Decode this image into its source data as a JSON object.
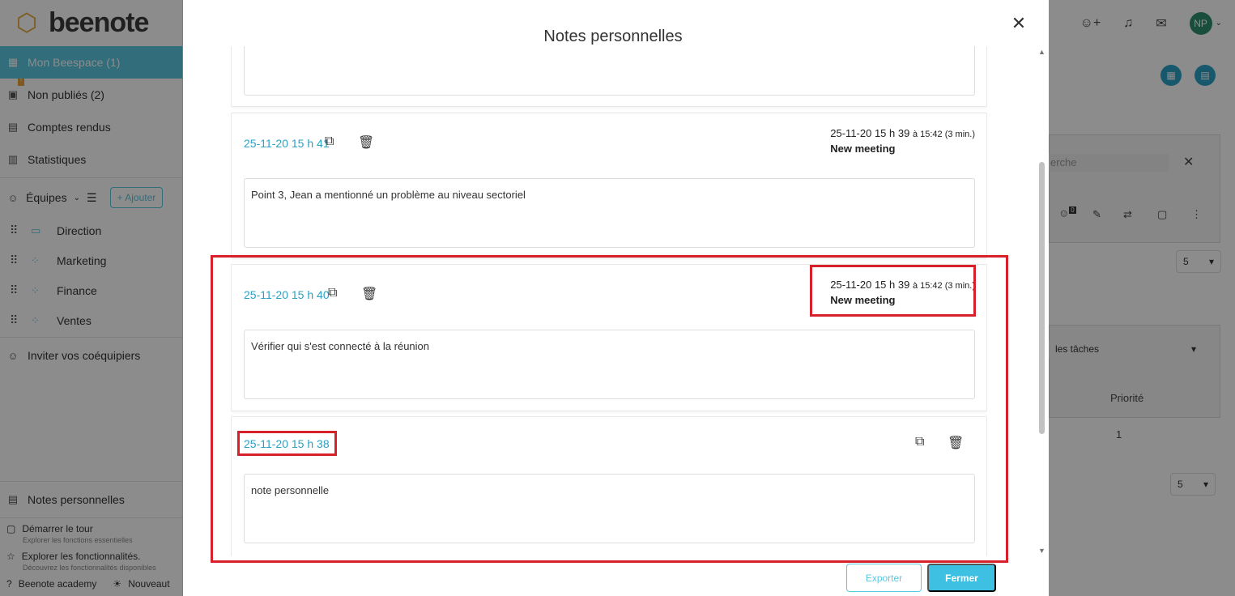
{
  "app": {
    "logo_text": "beenote",
    "nav": [
      {
        "label": "Mon Beespace (1)",
        "icon": "grid-icon"
      },
      {
        "label": "Non publiés (2)",
        "icon": "calendar-x-icon"
      },
      {
        "label": "Comptes rendus",
        "icon": "calendar-check-icon"
      },
      {
        "label": "Statistiques",
        "icon": "chart-icon"
      }
    ],
    "teams_label": "Équipes",
    "add_label": "Ajouter",
    "teams": [
      "Direction",
      "Marketing",
      "Finance",
      "Ventes"
    ],
    "invite_label": "Inviter vos coéquipiers",
    "personal_notes_label": "Notes personnelles",
    "tour_label": "Démarrer le tour",
    "tour_sub": "Explorer les fonctions essentielles",
    "explore_label": "Explorer les fonctionnalités.",
    "explore_sub": "Découvrez les fonctionnalités disponibles",
    "academy_label": "Beenote academy",
    "news_label": "Nouveaut",
    "avatar_initials": "NP",
    "right_panel": {
      "search_fragment": "erche",
      "badge_count": "0",
      "per_page_1": "5",
      "tasks_filter": "les tâches",
      "priority_header": "Priorité",
      "priority_value": "1",
      "per_page_2": "5"
    }
  },
  "modal": {
    "title": "Notes personnelles",
    "notes": [
      {
        "date": "",
        "meta_time": "",
        "meta_small": "",
        "meta_title": "",
        "body": ""
      },
      {
        "date": "25-11-20 15 h 41",
        "meta_time": "25-11-20 15 h 39",
        "meta_small": "à 15:42 (3 min.)",
        "meta_title": "New meeting",
        "body": "Point 3, Jean a mentionné un problème au niveau sectoriel"
      },
      {
        "date": "25-11-20 15 h 40",
        "meta_time": "25-11-20 15 h 39",
        "meta_small": "à 15:42 (3 min.)",
        "meta_title": "New meeting",
        "body": "Vérifier qui s'est connecté à la réunion"
      },
      {
        "date": "25-11-20 15 h 38",
        "body": "note personnelle"
      }
    ],
    "export_label": "Exporter",
    "close_label": "Fermer"
  }
}
